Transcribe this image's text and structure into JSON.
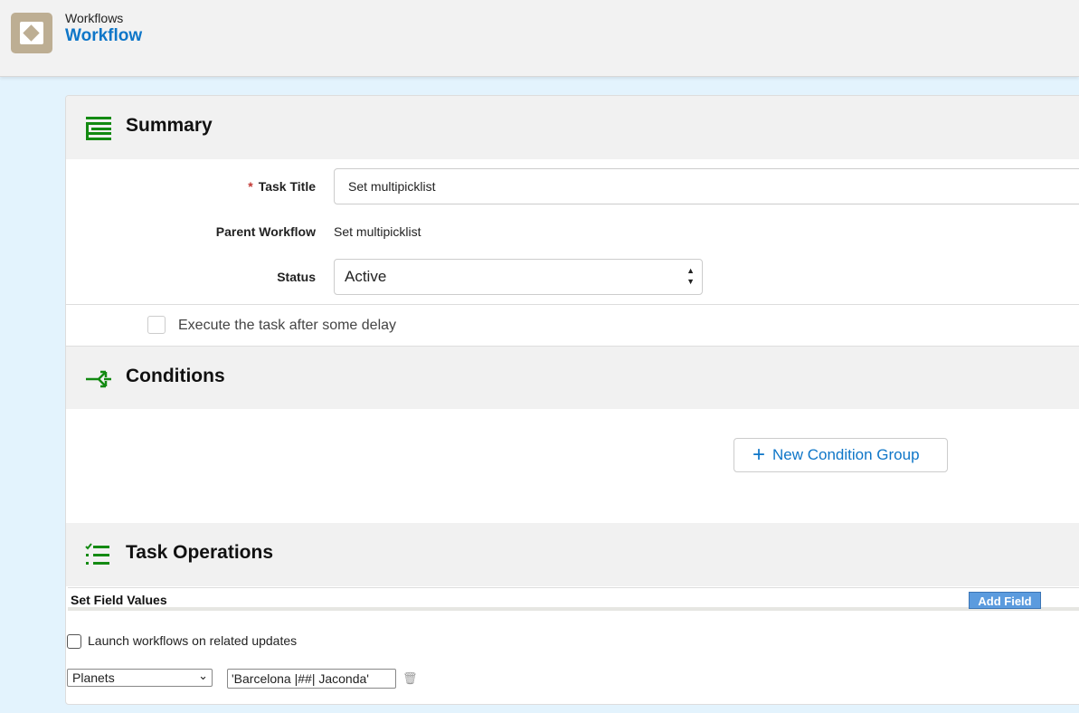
{
  "header": {
    "breadcrumb": "Workflows",
    "title": "Workflow"
  },
  "summary": {
    "heading": "Summary",
    "task_title_label": "Task Title",
    "task_title_value": "Set multipicklist",
    "parent_label": "Parent Workflow",
    "parent_value": "Set multipicklist",
    "status_label": "Status",
    "status_value": "Active",
    "delay_label": "Execute the task after some delay"
  },
  "conditions": {
    "heading": "Conditions",
    "new_group_label": "New Condition Group"
  },
  "operations": {
    "heading": "Task Operations",
    "set_field_values": "Set Field Values",
    "add_field": "Add Field",
    "launch_label": "Launch workflows on related updates",
    "field_select": "Planets",
    "field_value": "'Barcelona |##| Jaconda'"
  },
  "colors": {
    "accent": "#0e76c8",
    "icon_green": "#138a12",
    "logo": "#bdae93"
  }
}
